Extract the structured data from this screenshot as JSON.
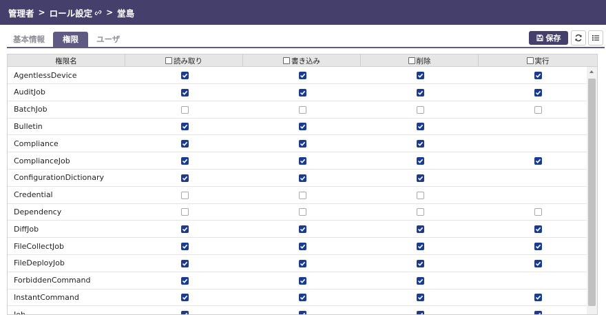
{
  "breadcrumb": {
    "root": "管理者",
    "section": "ロール設定",
    "current": "堂島",
    "link_icon": "link-icon"
  },
  "tabs": [
    {
      "label": "基本情報",
      "active": false
    },
    {
      "label": "権限",
      "active": true
    },
    {
      "label": "ユーザ",
      "active": false
    }
  ],
  "toolbar": {
    "save_label": "保存",
    "save_icon": "save-icon",
    "refresh_icon": "refresh-icon",
    "list_icon": "list-icon"
  },
  "table": {
    "columns": {
      "name": "権限名",
      "read": "読み取り",
      "write": "書き込み",
      "delete": "削除",
      "execute": "実行"
    },
    "rows": [
      {
        "name": "AgentlessDevice",
        "read": true,
        "write": true,
        "delete": true,
        "execute": true
      },
      {
        "name": "AuditJob",
        "read": true,
        "write": true,
        "delete": true,
        "execute": true
      },
      {
        "name": "BatchJob",
        "read": false,
        "write": false,
        "delete": false,
        "execute": false
      },
      {
        "name": "Bulletin",
        "read": true,
        "write": true,
        "delete": true,
        "execute": null
      },
      {
        "name": "Compliance",
        "read": true,
        "write": true,
        "delete": true,
        "execute": null
      },
      {
        "name": "ComplianceJob",
        "read": true,
        "write": true,
        "delete": true,
        "execute": true
      },
      {
        "name": "ConfigurationDictionary",
        "read": true,
        "write": true,
        "delete": true,
        "execute": null
      },
      {
        "name": "Credential",
        "read": false,
        "write": false,
        "delete": false,
        "execute": null
      },
      {
        "name": "Dependency",
        "read": false,
        "write": false,
        "delete": false,
        "execute": false
      },
      {
        "name": "DiffJob",
        "read": true,
        "write": true,
        "delete": true,
        "execute": true
      },
      {
        "name": "FileCollectJob",
        "read": true,
        "write": true,
        "delete": true,
        "execute": true
      },
      {
        "name": "FileDeployJob",
        "read": true,
        "write": true,
        "delete": true,
        "execute": true
      },
      {
        "name": "ForbiddenCommand",
        "read": true,
        "write": true,
        "delete": true,
        "execute": null
      },
      {
        "name": "InstantCommand",
        "read": true,
        "write": true,
        "delete": true,
        "execute": true
      },
      {
        "name": "Job",
        "read": true,
        "write": true,
        "delete": true,
        "execute": true
      }
    ]
  },
  "colors": {
    "header_bg": "#45406b",
    "tab_active": "#5e5a84",
    "checkbox_on": "#1a3c8f"
  }
}
